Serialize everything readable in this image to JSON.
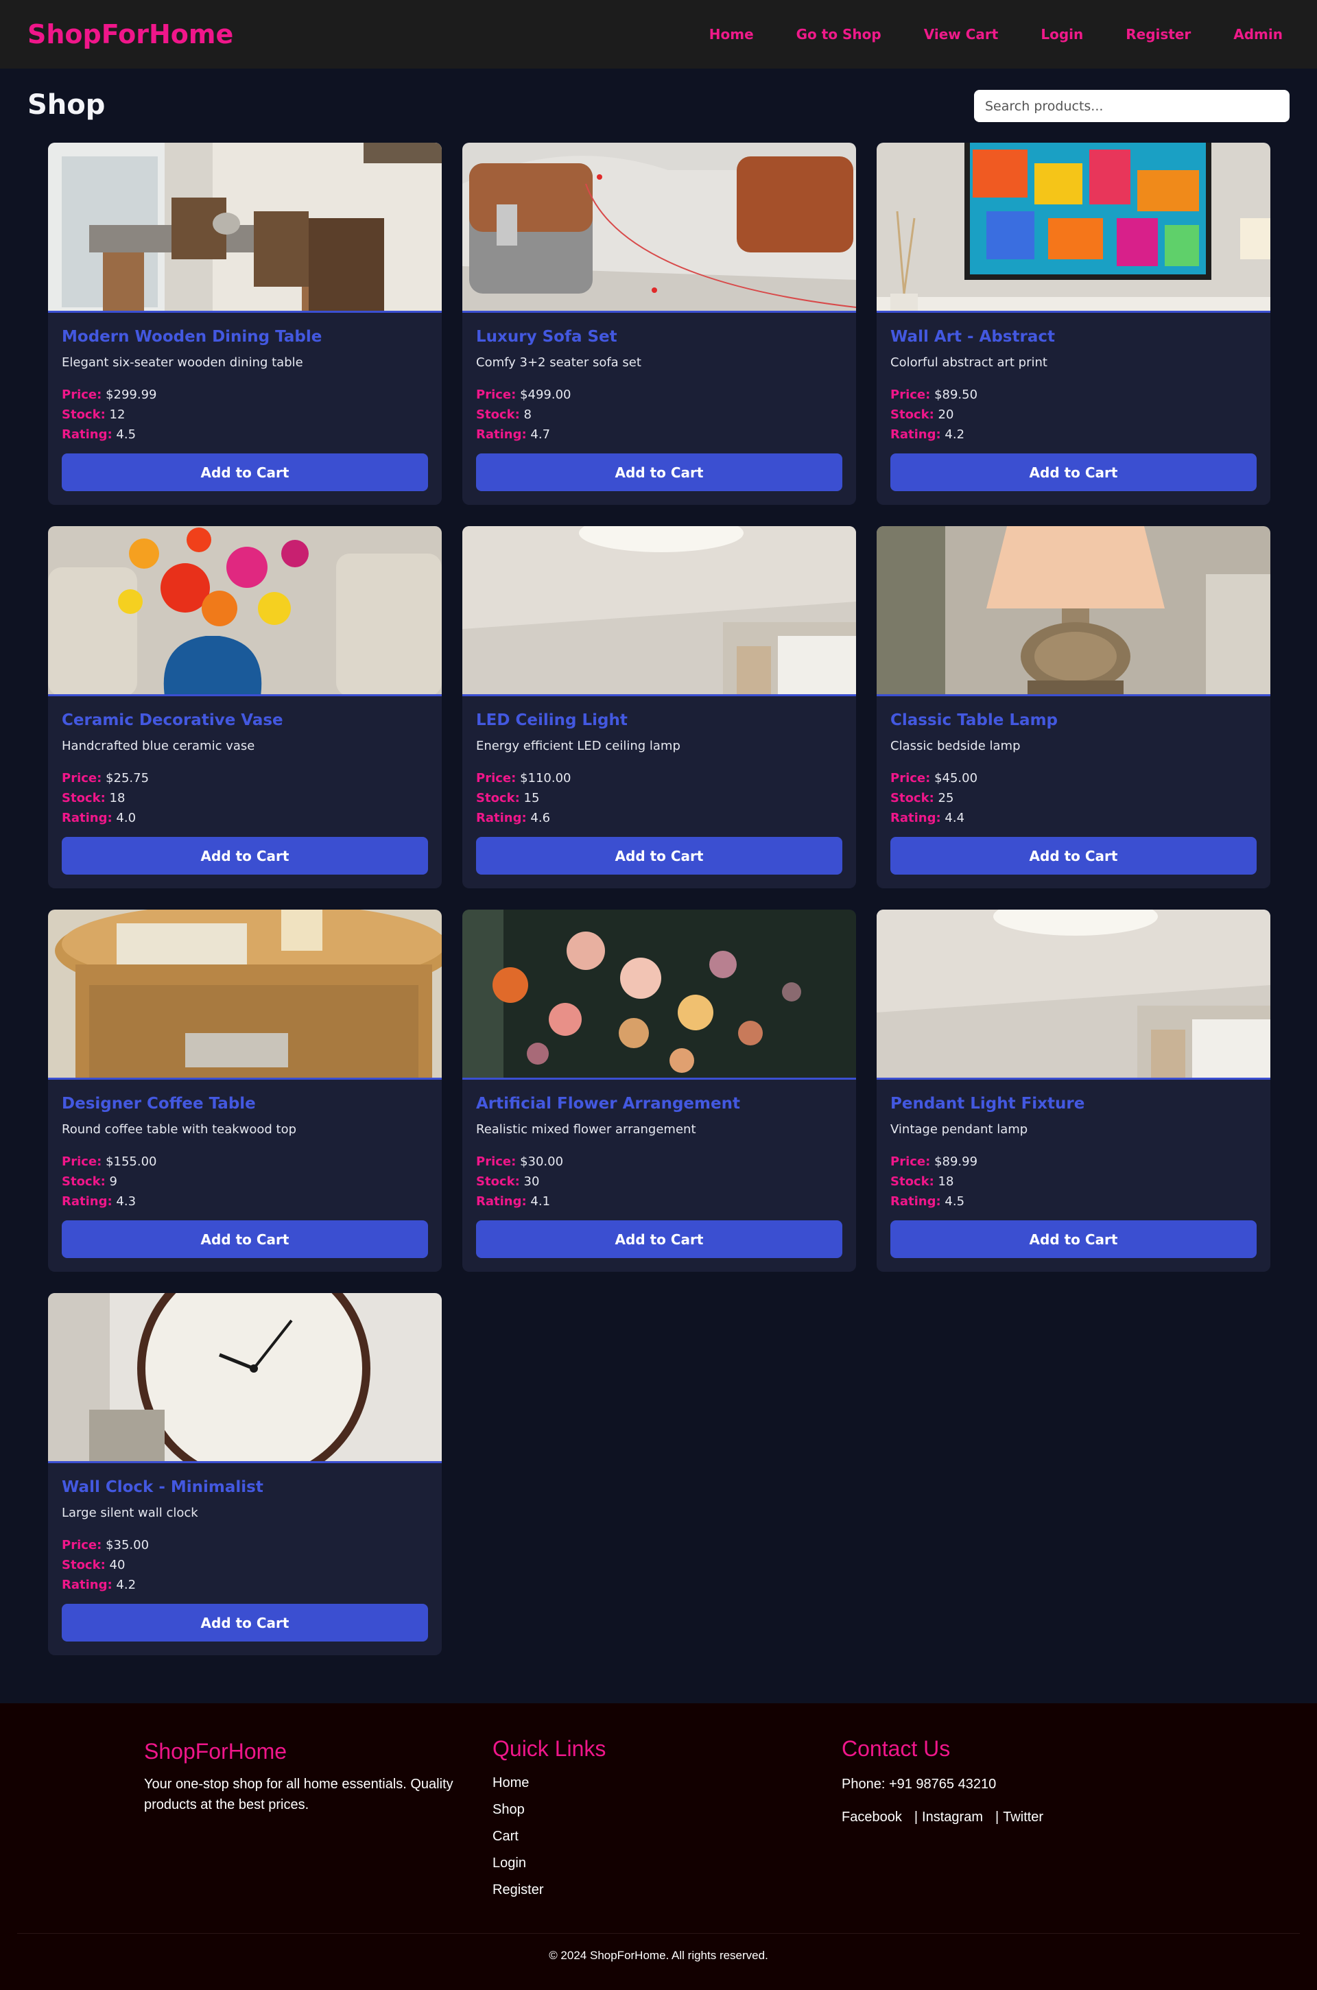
{
  "nav": {
    "brand": "ShopForHome",
    "links": [
      "Home",
      "Go to Shop",
      "View Cart",
      "Login",
      "Register",
      "Admin"
    ]
  },
  "header": {
    "title": "Shop",
    "search_placeholder": "Search products..."
  },
  "labels": {
    "price": "Price:",
    "stock": "Stock:",
    "rating": "Rating:",
    "add_to_cart": "Add to Cart"
  },
  "products": [
    {
      "name": "Modern Wooden Dining Table",
      "desc": "Elegant six-seater wooden dining table",
      "price": "$299.99",
      "stock": "12",
      "rating": "4.5",
      "image": "dining-table"
    },
    {
      "name": "Luxury Sofa Set",
      "desc": "Comfy 3+2 seater sofa set",
      "price": "$499.00",
      "stock": "8",
      "rating": "4.7",
      "image": "sofa"
    },
    {
      "name": "Wall Art - Abstract",
      "desc": "Colorful abstract art print",
      "price": "$89.50",
      "stock": "20",
      "rating": "4.2",
      "image": "wall-art"
    },
    {
      "name": "Ceramic Decorative Vase",
      "desc": "Handcrafted blue ceramic vase",
      "price": "$25.75",
      "stock": "18",
      "rating": "4.0",
      "image": "vase"
    },
    {
      "name": "LED Ceiling Light",
      "desc": "Energy efficient LED ceiling lamp",
      "price": "$110.00",
      "stock": "15",
      "rating": "4.6",
      "image": "ceiling-light"
    },
    {
      "name": "Classic Table Lamp",
      "desc": "Classic bedside lamp",
      "price": "$45.00",
      "stock": "25",
      "rating": "4.4",
      "image": "table-lamp"
    },
    {
      "name": "Designer Coffee Table",
      "desc": "Round coffee table with teakwood top",
      "price": "$155.00",
      "stock": "9",
      "rating": "4.3",
      "image": "coffee-table"
    },
    {
      "name": "Artificial Flower Arrangement",
      "desc": "Realistic mixed flower arrangement",
      "price": "$30.00",
      "stock": "30",
      "rating": "4.1",
      "image": "flowers"
    },
    {
      "name": "Pendant Light Fixture",
      "desc": "Vintage pendant lamp",
      "price": "$89.99",
      "stock": "18",
      "rating": "4.5",
      "image": "ceiling-light"
    },
    {
      "name": "Wall Clock - Minimalist",
      "desc": "Large silent wall clock",
      "price": "$35.00",
      "stock": "40",
      "rating": "4.2",
      "image": "wall-clock"
    }
  ],
  "footer": {
    "brand": "ShopForHome",
    "tagline": "Your one-stop shop for all home essentials. Quality products at the best prices.",
    "quick_links_title": "Quick Links",
    "quick_links": [
      "Home",
      "Shop",
      "Cart",
      "Login",
      "Register"
    ],
    "contact_title": "Contact Us",
    "phone": "Phone: +91 98765 43210",
    "socials": [
      "Facebook",
      "Instagram",
      "Twitter"
    ],
    "copyright": "© 2024 ShopForHome. All rights reserved."
  },
  "colors": {
    "accent_pink": "#f0168a",
    "accent_blue": "#3b4fd1",
    "page_bg": "#0e1222",
    "card_bg": "#1b1f36",
    "footer_bg": "#120000"
  }
}
